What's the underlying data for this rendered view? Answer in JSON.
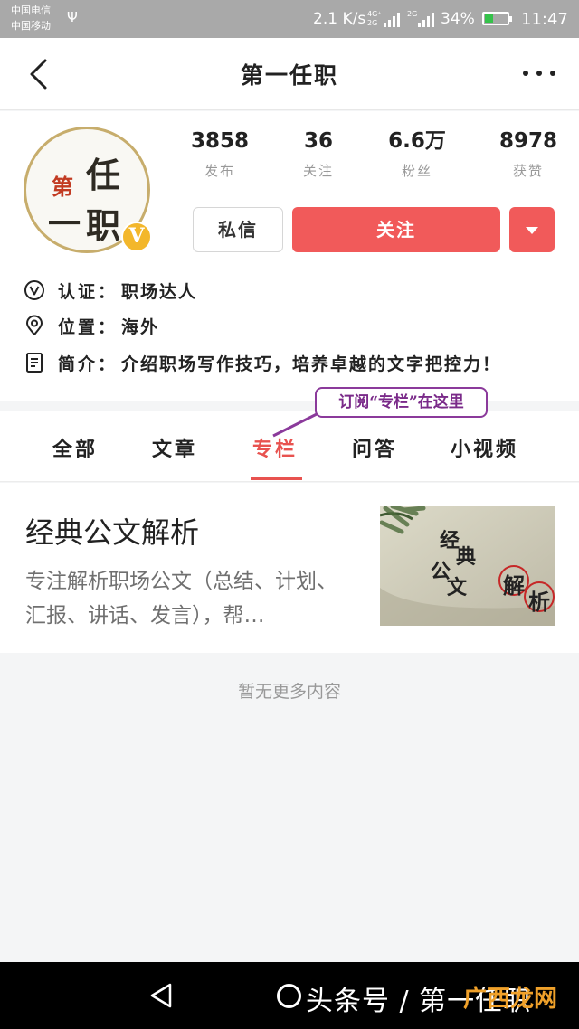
{
  "status_bar": {
    "carrier1": "中国电信",
    "carrier2": "中国移动",
    "speed": "2.1 K/s",
    "net1_top": "4G⁺",
    "net1_bottom": "2G",
    "net2": "2G",
    "battery_pct": "34%",
    "battery_level": 0.34,
    "time": "11:47"
  },
  "header": {
    "title": "第一任职"
  },
  "profile": {
    "avatar_chars": [
      "第",
      "任",
      "一",
      "职"
    ],
    "verified_badge": "V",
    "stats": [
      {
        "value": "3858",
        "label": "发布"
      },
      {
        "value": "36",
        "label": "关注"
      },
      {
        "value": "6.6万",
        "label": "粉丝"
      },
      {
        "value": "8978",
        "label": "获赞"
      }
    ],
    "message_button": "私信",
    "follow_button": "关注",
    "info": [
      {
        "icon": "verified-icon",
        "label": "认证：",
        "value": "职场达人"
      },
      {
        "icon": "location-icon",
        "label": "位置：",
        "value": "海外"
      },
      {
        "icon": "document-icon",
        "label": "简介：",
        "value": "介绍职场写作技巧，培养卓越的文字把控力！"
      }
    ]
  },
  "callout": {
    "text": "订阅“专栏”在这里"
  },
  "tabs": [
    {
      "label": "全部"
    },
    {
      "label": "文章"
    },
    {
      "label": "专栏",
      "active": true
    },
    {
      "label": "问答"
    },
    {
      "label": "小视频"
    }
  ],
  "article": {
    "title": "经典公文解析",
    "description": "专注解析职场公文（总结、计划、汇报、讲话、发言），帮…",
    "thumb_text": [
      "经",
      "典",
      "公",
      "文",
      "解",
      "析"
    ]
  },
  "footer_text": "暂无更多内容",
  "nav_bar": {
    "watermark": "头条号 / 第一任职",
    "watermark2": "广西龙网"
  },
  "colors": {
    "accent": "#f15a5a",
    "tab_active": "#e8524f",
    "callout": "#8b3a9b",
    "badge": "#f3b72b"
  }
}
